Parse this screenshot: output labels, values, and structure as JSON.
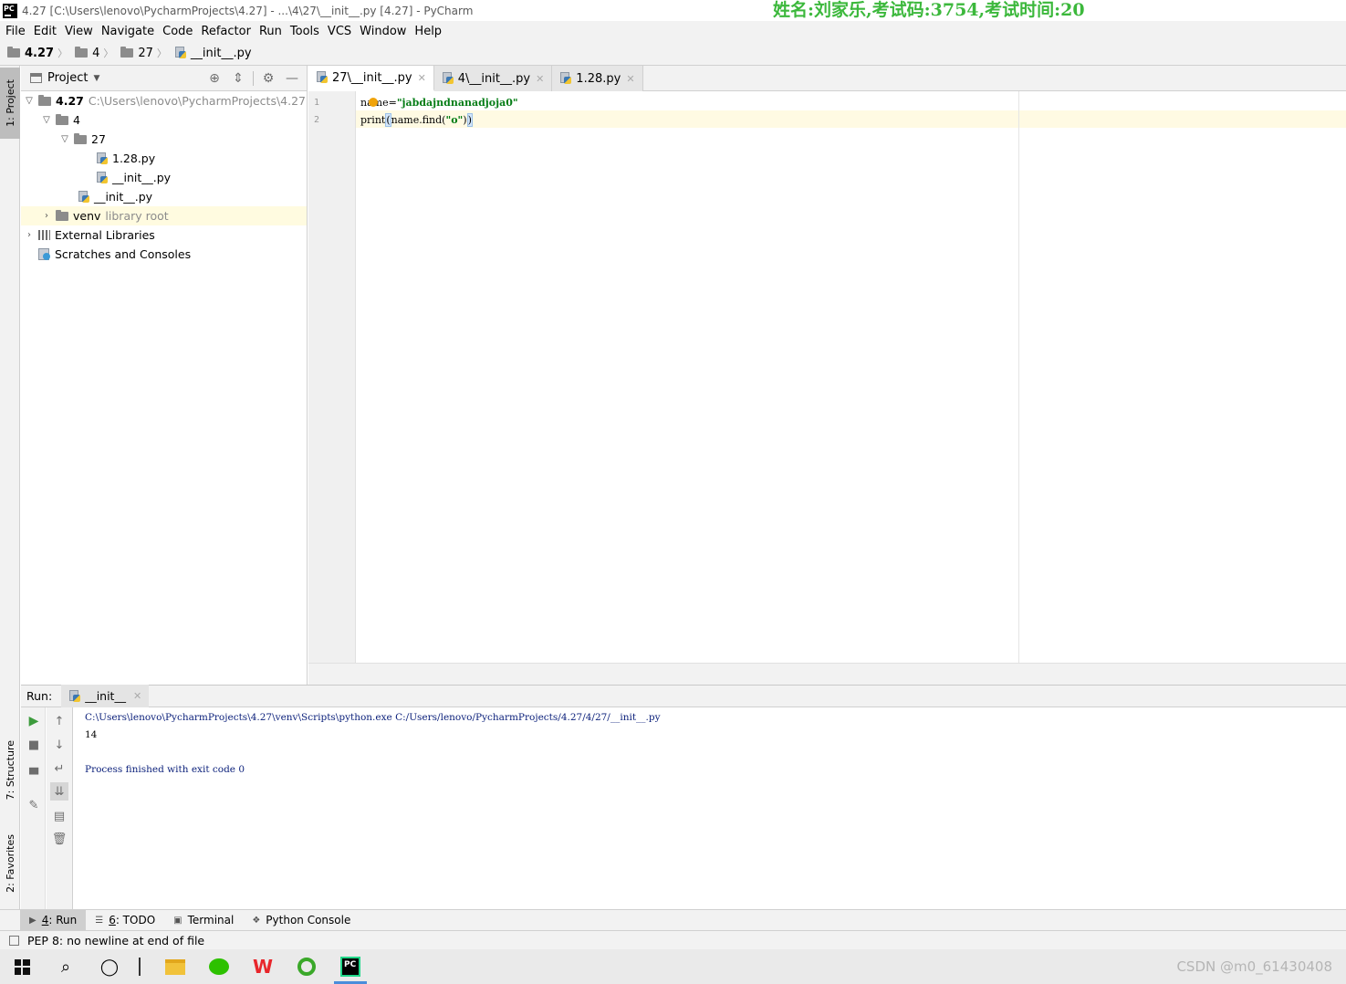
{
  "window": {
    "title": "4.27 [C:\\Users\\lenovo\\PycharmProjects\\4.27] - ...\\4\\27\\__init__.py [4.27] - PyCharm",
    "app_logo": "PC",
    "exam_banner": "姓名:刘家乐,考试码:3754,考试时间:20"
  },
  "menu": [
    "File",
    "Edit",
    "View",
    "Navigate",
    "Code",
    "Refactor",
    "Run",
    "Tools",
    "VCS",
    "Window",
    "Help"
  ],
  "breadcrumb": [
    "4.27",
    "4",
    "27",
    "__init__.py"
  ],
  "left_stripe": {
    "project": "1: Project",
    "structure": "7: Structure",
    "favorites": "2: Favorites"
  },
  "project_panel": {
    "title": "Project",
    "tree": [
      {
        "label": "4.27",
        "detail": "C:\\Users\\lenovo\\PycharmProjects\\4.27"
      },
      {
        "label": "4"
      },
      {
        "label": "27"
      },
      {
        "label": "1.28.py"
      },
      {
        "label": "__init__.py"
      },
      {
        "label": "__init__.py"
      },
      {
        "label": "venv",
        "detail": "library root"
      },
      {
        "label": "External Libraries"
      },
      {
        "label": "Scratches and Consoles"
      }
    ]
  },
  "editor": {
    "tabs": [
      "27\\__init__.py",
      "4\\__init__.py",
      "1.28.py"
    ],
    "line_numbers": [
      "1",
      "2"
    ],
    "line1": {
      "prefix": "name=",
      "string": "\"jabdajndnanadjoja0\""
    },
    "line2": {
      "a": "print",
      "open": "(",
      "b": "name.find(",
      "str": "\"o\"",
      "c": ")",
      "close": ")"
    }
  },
  "run": {
    "label": "Run:",
    "tab": "__init__",
    "output": [
      "C:\\Users\\lenovo\\PycharmProjects\\4.27\\venv\\Scripts\\python.exe C:/Users/lenovo/PycharmProjects/4.27/4/27/__init__.py",
      "14",
      "Process finished with exit code 0"
    ]
  },
  "tool_windows": [
    {
      "num": "4",
      "label": ": Run",
      "icon": "play-icon"
    },
    {
      "num": "6",
      "label": ": TODO",
      "icon": "list-icon"
    },
    {
      "num": "",
      "label": "Terminal",
      "icon": "terminal-icon"
    },
    {
      "num": "",
      "label": "Python Console",
      "icon": "python-icon"
    }
  ],
  "status": "PEP 8: no newline at end of file",
  "watermark": "CSDN @m0_61430408"
}
